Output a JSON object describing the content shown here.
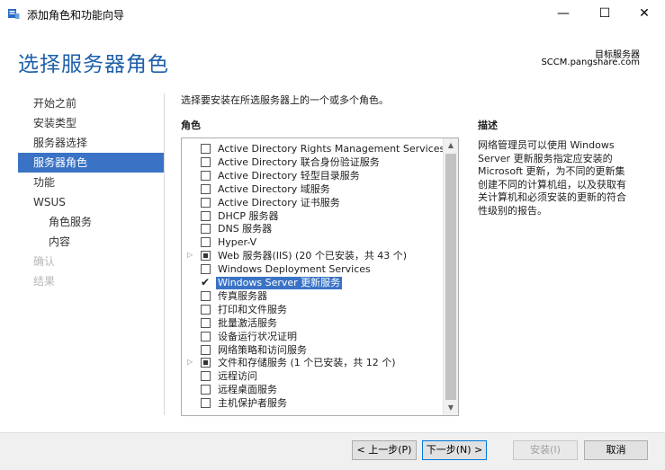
{
  "window": {
    "title": "添加角色和功能向导",
    "minimize_glyph": "—",
    "maximize_glyph": "☐",
    "close_glyph": "✕"
  },
  "header": {
    "page_title": "选择服务器角色",
    "target_label": "目标服务器",
    "target_server": "SCCM.pangshare.com"
  },
  "nav": [
    {
      "label": "开始之前",
      "state": "normal"
    },
    {
      "label": "安装类型",
      "state": "normal"
    },
    {
      "label": "服务器选择",
      "state": "normal"
    },
    {
      "label": "服务器角色",
      "state": "active"
    },
    {
      "label": "功能",
      "state": "normal"
    },
    {
      "label": "WSUS",
      "state": "normal"
    },
    {
      "label": "角色服务",
      "state": "sub"
    },
    {
      "label": "内容",
      "state": "sub"
    },
    {
      "label": "确认",
      "state": "disabled"
    },
    {
      "label": "结果",
      "state": "disabled"
    }
  ],
  "main": {
    "instruction": "选择要安装在所选服务器上的一个或多个角色。",
    "roles_header": "角色",
    "roles": [
      {
        "label": "Active Directory Rights Management Services",
        "state": "unchecked",
        "expandable": false
      },
      {
        "label": "Active Directory 联合身份验证服务",
        "state": "unchecked",
        "expandable": false
      },
      {
        "label": "Active Directory 轻型目录服务",
        "state": "unchecked",
        "expandable": false
      },
      {
        "label": "Active Directory 域服务",
        "state": "unchecked",
        "expandable": false
      },
      {
        "label": "Active Directory 证书服务",
        "state": "unchecked",
        "expandable": false
      },
      {
        "label": "DHCP 服务器",
        "state": "unchecked",
        "expandable": false
      },
      {
        "label": "DNS 服务器",
        "state": "unchecked",
        "expandable": false
      },
      {
        "label": "Hyper-V",
        "state": "unchecked",
        "expandable": false
      },
      {
        "label": "Web 服务器(IIS) (20 个已安装，共 43 个)",
        "state": "partial",
        "expandable": true
      },
      {
        "label": "Windows Deployment Services",
        "state": "unchecked",
        "expandable": false
      },
      {
        "label": "Windows Server 更新服务",
        "state": "checked",
        "expandable": false,
        "selected": true
      },
      {
        "label": "传真服务器",
        "state": "unchecked",
        "expandable": false
      },
      {
        "label": "打印和文件服务",
        "state": "unchecked",
        "expandable": false
      },
      {
        "label": "批量激活服务",
        "state": "unchecked",
        "expandable": false
      },
      {
        "label": "设备运行状况证明",
        "state": "unchecked",
        "expandable": false
      },
      {
        "label": "网络策略和访问服务",
        "state": "unchecked",
        "expandable": false
      },
      {
        "label": "文件和存储服务 (1 个已安装，共 12 个)",
        "state": "partial",
        "expandable": true
      },
      {
        "label": "远程访问",
        "state": "unchecked",
        "expandable": false
      },
      {
        "label": "远程桌面服务",
        "state": "unchecked",
        "expandable": false
      },
      {
        "label": "主机保护者服务",
        "state": "unchecked",
        "expandable": false
      }
    ],
    "description_header": "描述",
    "description": "网络管理员可以使用 Windows Server 更新服务指定应安装的 Microsoft 更新，为不同的更新集创建不同的计算机组，以及获取有关计算机和必须安装的更新的符合性级别的报告。"
  },
  "footer": {
    "prev_label": "< 上一步(P)",
    "next_label": "下一步(N) >",
    "install_label": "安装(I)",
    "cancel_label": "取消"
  },
  "colors": {
    "accent": "#3a73c5",
    "title_blue": "#1e5fa8"
  }
}
